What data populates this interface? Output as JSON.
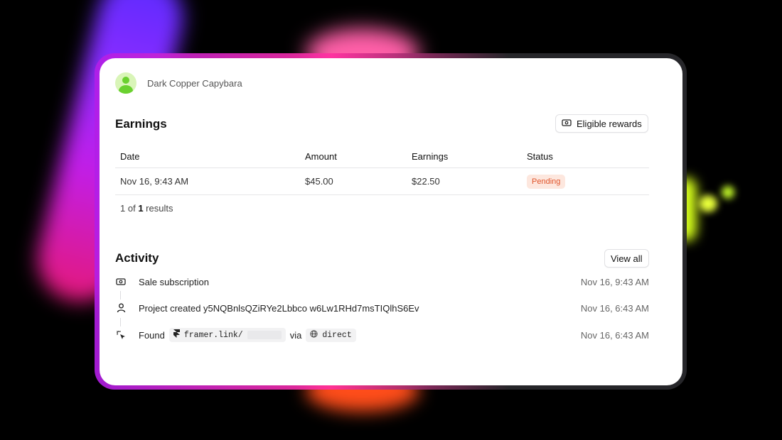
{
  "user": {
    "name": "Dark Copper Capybara"
  },
  "earnings": {
    "title": "Earnings",
    "eligible_button": "Eligible rewards",
    "columns": [
      "Date",
      "Amount",
      "Earnings",
      "Status"
    ],
    "rows": [
      {
        "date": "Nov 16, 9:43 AM",
        "amount": "$45.00",
        "earnings": "$22.50",
        "status": "Pending"
      }
    ],
    "results_prefix": "1 of",
    "results_count": "1",
    "results_suffix": "results"
  },
  "activity": {
    "title": "Activity",
    "view_all_button": "View all",
    "items": [
      {
        "icon": "money-icon",
        "text": "Sale subscription",
        "time": "Nov 16, 9:43 AM"
      },
      {
        "icon": "user-icon",
        "text": "Project created y5NQBnlsQZiRYe2Lbbco w6Lw1RHd7msTIQlhS6Ev",
        "time": "Nov 16, 6:43 AM"
      },
      {
        "icon": "cursor-click-icon",
        "found_label": "Found",
        "link": "framer.link/",
        "via_label": "via",
        "source": "direct",
        "time": "Nov 16, 6:43 AM"
      }
    ]
  },
  "colors": {
    "pending_text": "#e0542a",
    "pending_bg": "#fde7de",
    "avatar": "#6ad12f"
  }
}
